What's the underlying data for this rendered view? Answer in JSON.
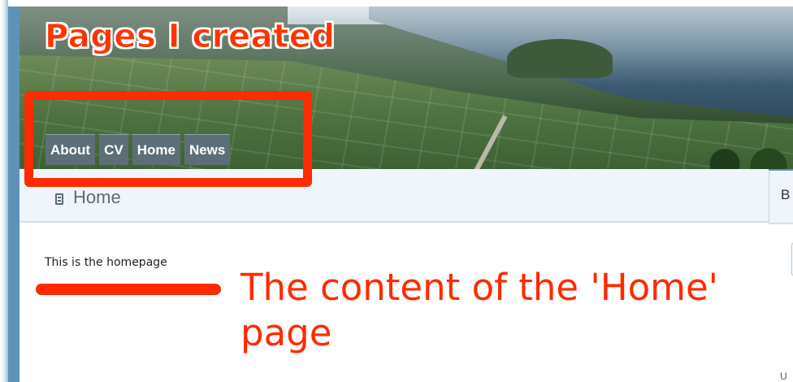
{
  "annotations": {
    "header_callout": "Pages I created",
    "content_callout": "The content of the 'Home' page"
  },
  "nav": {
    "tabs": [
      {
        "label": "About"
      },
      {
        "label": "CV"
      },
      {
        "label": "Home"
      },
      {
        "label": "News"
      }
    ]
  },
  "page": {
    "title": "Home",
    "body_text": "This is the homepage"
  },
  "sidebar": {
    "header_label": "B",
    "bottom_label": "U"
  },
  "colors": {
    "annotation": "#ff2a00",
    "nav_tab_bg": "#5c6f78",
    "page_header_bg": "#f0f5fb"
  }
}
